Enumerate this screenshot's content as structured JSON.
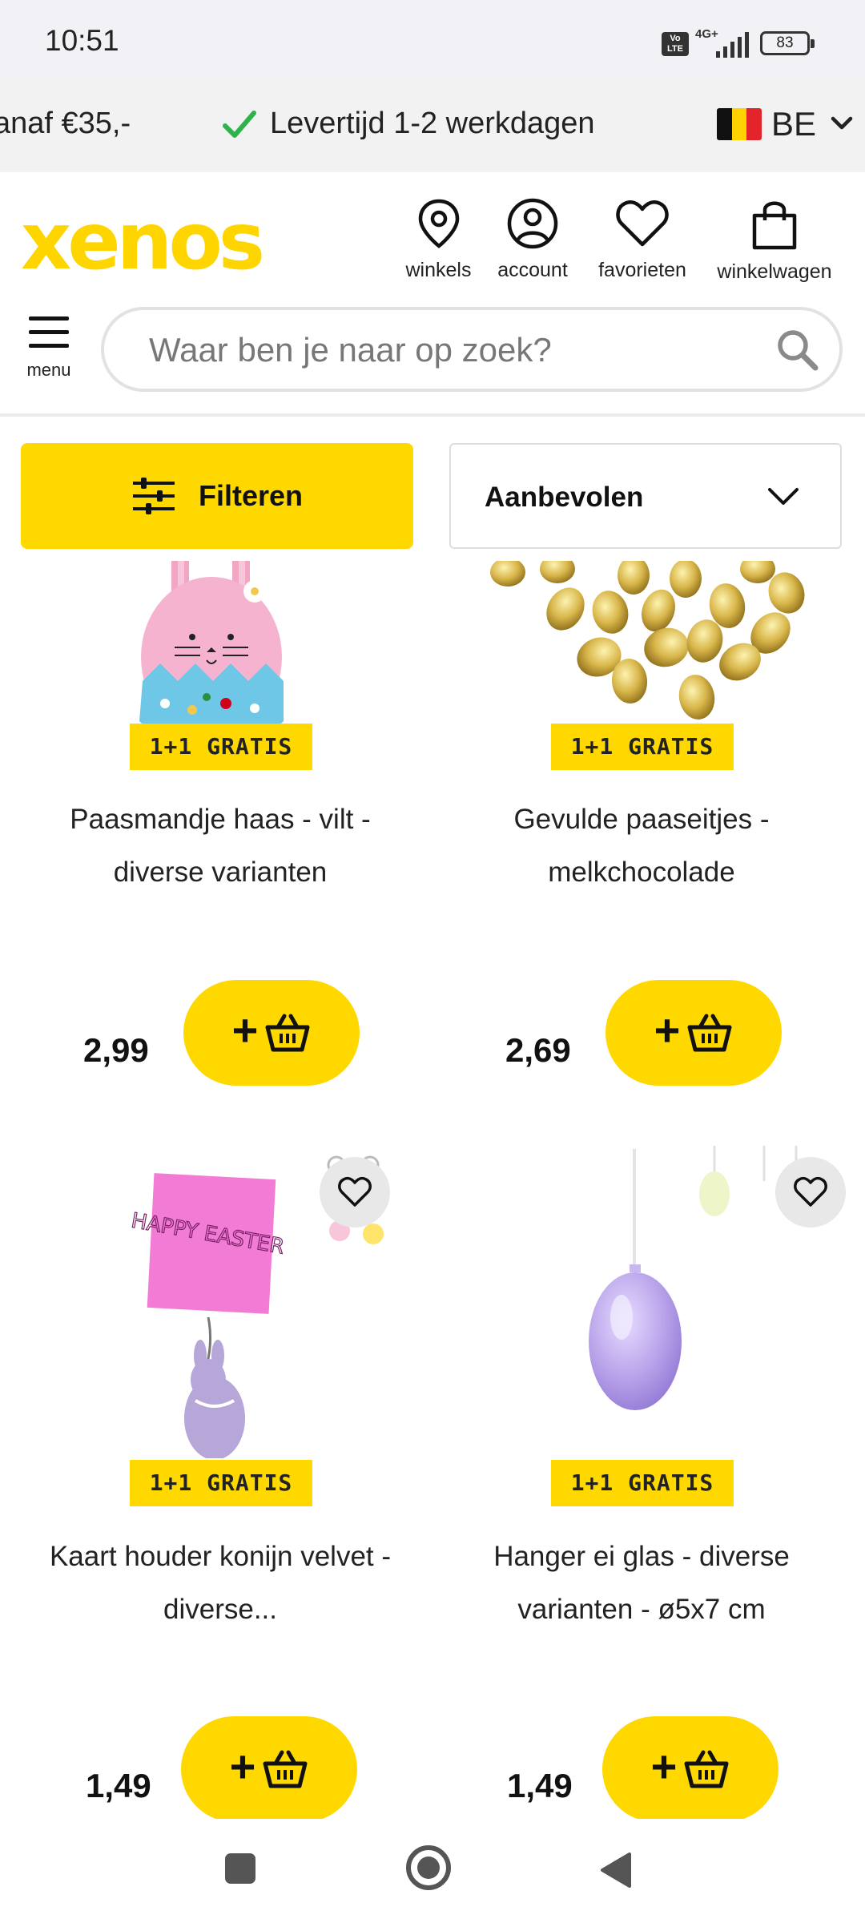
{
  "status_bar": {
    "time": "10:51",
    "volte": "Vo LTE",
    "network": "4G+",
    "battery": "83"
  },
  "promo": {
    "left_text": "anaf €35,-",
    "delivery_text": "Levertijd 1-2 werkdagen",
    "country": "BE"
  },
  "header": {
    "logo": "xenos",
    "icons": [
      {
        "name": "location-pin-icon",
        "label": "winkels"
      },
      {
        "name": "user-icon",
        "label": "account"
      },
      {
        "name": "heart-icon",
        "label": "favorieten"
      },
      {
        "name": "shopping-bag-icon",
        "label": "winkelwagen"
      }
    ],
    "menu_label": "menu",
    "search_placeholder": "Waar ben je naar op zoek?"
  },
  "toolbar": {
    "filter_label": "Filteren",
    "sort_label": "Aanbevolen"
  },
  "products": [
    {
      "badge": "1+1 GRATIS",
      "title": "Paasmandje haas - vilt - diverse varianten",
      "price": "2,99"
    },
    {
      "badge": "1+1 GRATIS",
      "title": "Gevulde paaseitjes - melkchocolade",
      "price": "2,69"
    },
    {
      "badge": "1+1 GRATIS",
      "title": "Kaart houder konijn velvet - diverse...",
      "price": "1,49",
      "card_text": "HAPPY EASTER"
    },
    {
      "badge": "1+1 GRATIS",
      "title": "Hanger ei glas - diverse varianten - ø5x7 cm",
      "price": "1,49"
    }
  ],
  "colors": {
    "brand_yellow": "#ffd800",
    "check_green": "#2db34a"
  }
}
